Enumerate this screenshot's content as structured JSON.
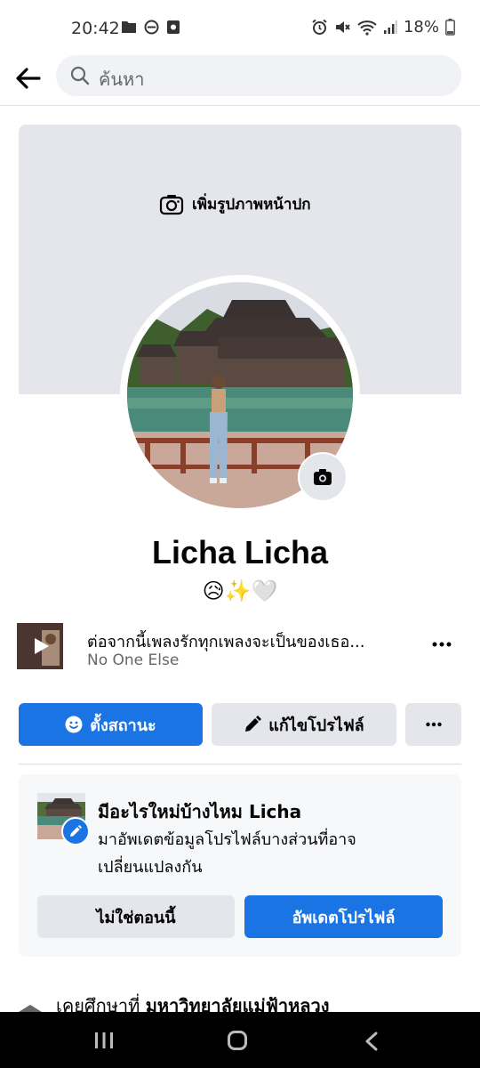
{
  "status_bar": {
    "time": "20:42",
    "battery": "18%"
  },
  "search": {
    "placeholder": "ค้นหา"
  },
  "cover": {
    "add_cover_label": "เพิ่มรูปภาพหน้าปก"
  },
  "profile": {
    "name": "Licha Licha",
    "bio": "😥✨🤍"
  },
  "music": {
    "title": "ต่อจากนี้เพลงรักทุกเพลงจะเป็นของเธอ...",
    "artist": "No One Else"
  },
  "actions": {
    "status_label": "ตั้งสถานะ",
    "edit_label": "แก้ไขโปรไฟล์"
  },
  "update_card": {
    "title": "มีอะไรใหม่บ้างไหม Licha",
    "text": "มาอัพเดตข้อมูลโปรไฟล์บางส่วนที่อาจเปลี่ยนแปลงกัน",
    "not_now_label": "ไม่ใช่ตอนนี้",
    "update_label": "อัพเดตโปรไฟล์"
  },
  "education": {
    "prefix": "เคยศึกษาที่ ",
    "school": "มหาวิทยาลัยแม่ฟ้าหลวง"
  },
  "colors": {
    "primary": "#1b74e4",
    "button_gray": "#e4e6eb",
    "cover_gray": "#e4e6eb"
  }
}
